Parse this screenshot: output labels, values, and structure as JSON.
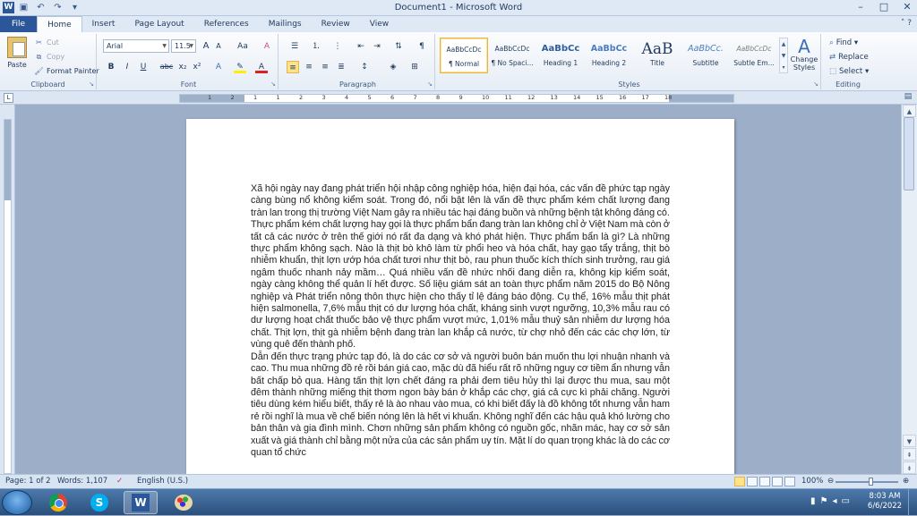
{
  "window": {
    "title": "Document1 - Microsoft Word",
    "app_icon": "W"
  },
  "quick_access": [
    "save-icon",
    "undo-icon",
    "redo-icon"
  ],
  "window_buttons": {
    "minimize": "–",
    "maximize": "□",
    "close": "✕"
  },
  "tabs": [
    {
      "label": "File"
    },
    {
      "label": "Home"
    },
    {
      "label": "Insert"
    },
    {
      "label": "Page Layout"
    },
    {
      "label": "References"
    },
    {
      "label": "Mailings"
    },
    {
      "label": "Review"
    },
    {
      "label": "View"
    }
  ],
  "clipboard": {
    "paste": "Paste",
    "cut": "Cut",
    "copy": "Copy",
    "format_painter": "Format Painter",
    "label": "Clipboard"
  },
  "font": {
    "name": "Arial",
    "size": "11.5",
    "label": "Font",
    "bold": "B",
    "italic": "I",
    "underline": "U",
    "strike": "abc",
    "sub": "x₂",
    "sup": "x²",
    "grow": "A",
    "shrink": "A",
    "case": "Aa",
    "clear": "A"
  },
  "paragraph": {
    "label": "Paragraph",
    "pilcrow": "¶"
  },
  "styles": {
    "label": "Styles",
    "items": [
      {
        "sample": "AaBbCcDc",
        "name": "¶ Normal"
      },
      {
        "sample": "AaBbCcDc",
        "name": "¶ No Spaci..."
      },
      {
        "sample": "AaBbCc",
        "name": "Heading 1"
      },
      {
        "sample": "AaBbCc",
        "name": "Heading 2"
      },
      {
        "sample": "AaB",
        "name": "Title"
      },
      {
        "sample": "AaBbCc.",
        "name": "Subtitle"
      },
      {
        "sample": "AaBbCcDc",
        "name": "Subtle Em..."
      }
    ],
    "change_styles": "Change Styles"
  },
  "editing": {
    "label": "Editing",
    "find": "Find",
    "replace": "Replace",
    "select": "Select"
  },
  "ruler": {
    "numbers": [
      "1",
      "2",
      "1",
      "1",
      "2",
      "3",
      "4",
      "5",
      "6",
      "7",
      "8",
      "9",
      "10",
      "11",
      "12",
      "13",
      "14",
      "15",
      "16",
      "17",
      "18"
    ]
  },
  "document": {
    "paragraphs": [
      "Xã hội ngày nay đang phát triển hội nhập công nghiệp hóa, hiện đại hóa, các vấn đề phức tạp ngày càng bùng nổ không kiểm soát. Trong đó, nổi bật lên là vấn đề thực phẩm kém chất lượng đang tràn lan trong thị trường Việt Nam gây ra nhiều tác hại đáng buồn và những bệnh tật không đáng có.",
      "Thực phẩm kém chất lượng hay gọi là thực phẩm bẩn đang tràn lan không chỉ ở Việt Nam mà còn ở tất cả các nước ở trên thế giới nó rất đa dạng và khó phát hiện. Thực phẩm bẩn là gì? Là những thực phẩm không sạch. Nào là thịt bò khô làm từ phổi heo và hóa chất, hay gạo tẩy trắng, thịt bò nhiễm khuẩn, thịt lợn ướp hóa chất tươi như thịt bò, rau phun thuốc kích thích sinh trưởng, rau giá ngâm thuốc nhanh nảy mầm… Quá nhiều vấn đề nhức nhối đang diễn ra, không kịp kiểm soát, ngày càng không thể quản lí hết được. Số liệu giám sát an toàn thực phẩm năm 2015 do Bộ Nông nghiệp và Phát triển nông thôn thực hiện cho thấy tỉ lệ đáng báo động. Cụ thể, 16% mẫu thịt phát hiện salmonella, 7,6% mẫu thịt có dư lượng hóa chất, kháng sinh vượt ngưỡng, 10,3% mẫu rau có dư lượng hoạt chất thuốc bảo vệ thực phẩm vượt mức, 1,01% mẫu thuỷ sản nhiễm dư lượng hóa chất. Thịt lợn, thịt gà nhiễm bệnh đang tràn lan khắp cả nước, từ chợ nhỏ đến các các chợ lớn, từ vùng quê đến thành phố.",
      "Dẫn đến thực trạng phức tạp đó, là do các cơ sở và người buôn bán muốn thu lợi nhuận nhanh và cao. Thu mua những đồ rẻ rồi bán giá cao, mặc dù đã hiểu rất rõ những nguy cơ tiềm ẩn nhưng vẫn bất chấp bỏ qua. Hàng tấn thịt lợn chết đáng ra phải đem tiêu hủy thì lại được thu mua, sau một đêm thành những miếng thịt thơm ngon bày bán ở khắp các chợ, giá cả cực kì phải chăng. Người tiêu dùng kém hiểu biết, thấy rẻ là ào nhau vào mua, có khi biết đấy là đồ không tốt nhưng vẫn ham rẻ rồi nghĩ là mua về chế biến nóng lên là hết vi khuẩn. Không nghĩ đến các hậu quả khó lường cho bản thân và gia đình mình. Chơn những sản phẩm không có nguồn gốc, nhãn mác, hay cơ sở sản xuất và giá thành chỉ bằng một nửa của các sản phẩm uy tín. Mặt lí do quan trọng khác là do các cơ quan tổ chức"
    ]
  },
  "status": {
    "page": "Page: 1 of 2",
    "words": "Words: 1,107",
    "language": "English (U.S.)",
    "zoom": "100%",
    "zoom_level": 1.0
  },
  "taskbar": {
    "apps": [
      "chrome",
      "skype",
      "word",
      "paint"
    ],
    "active": "word",
    "time": "8:03 AM",
    "date": "6/6/2022"
  },
  "colors": {
    "file_tab": "#2b579a",
    "accent": "#ffe28a",
    "spell_underline": "#d23b3b"
  }
}
